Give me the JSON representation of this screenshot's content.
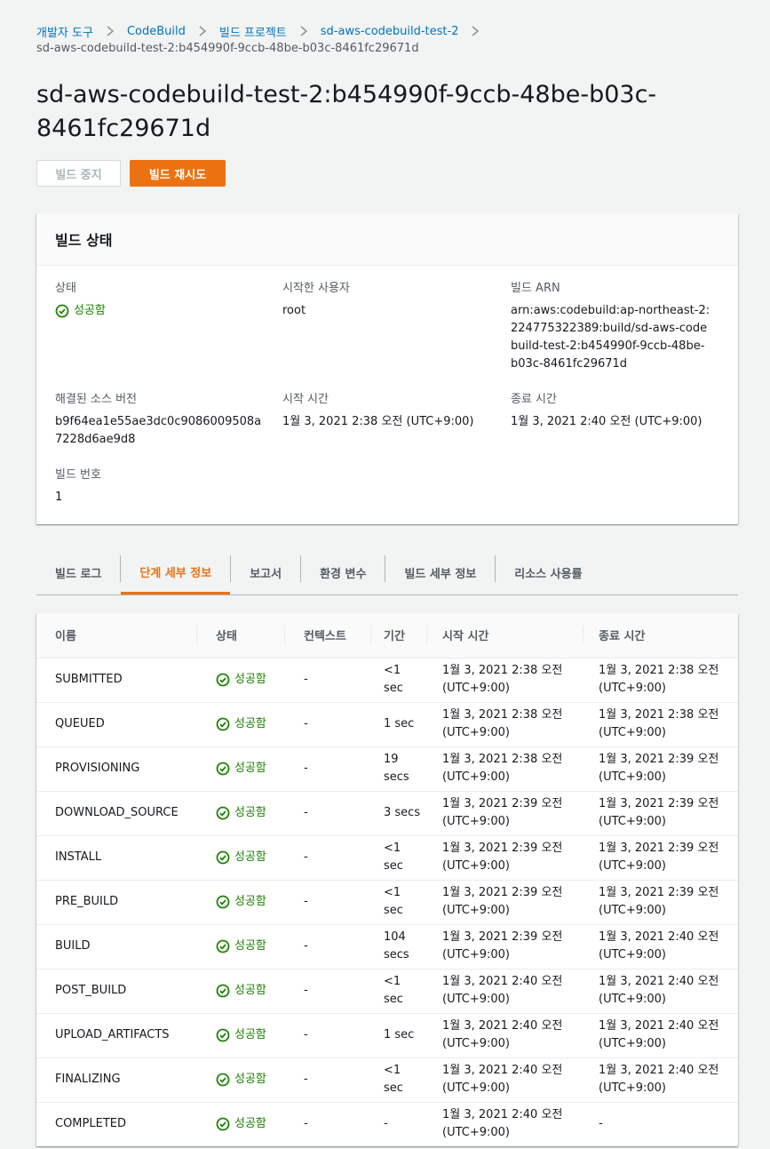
{
  "breadcrumb": {
    "items": [
      "개발자 도구",
      "CodeBuild",
      "빌드 프로젝트",
      "sd-aws-codebuild-test-2"
    ],
    "current": "sd-aws-codebuild-test-2:b454990f-9ccb-48be-b03c-8461fc29671d"
  },
  "page": {
    "title": "sd-aws-codebuild-test-2:b454990f-9ccb-48be-b03c-8461fc29671d"
  },
  "actions": {
    "stop_label": "빌드 중지",
    "retry_label": "빌드 재시도"
  },
  "colors": {
    "accent": "#ec7211",
    "link": "#0073bb",
    "success": "#1d8102"
  },
  "build_status": {
    "heading": "빌드 상태",
    "status_label": "상태",
    "status_value": "성공함",
    "initiator_label": "시작한 사용자",
    "initiator_value": "root",
    "arn_label": "빌드 ARN",
    "arn_value": "arn:aws:codebuild:ap-northeast-2:224775322389:build/sd-aws-codebuild-test-2:b454990f-9ccb-48be-b03c-8461fc29671d",
    "source_version_label": "해결된 소스 버전",
    "source_version_value": "b9f64ea1e55ae3dc0c9086009508a7228d6ae9d8",
    "start_time_label": "시작 시간",
    "start_time_value": "1월 3, 2021 2:38 오전 (UTC+9:00)",
    "end_time_label": "종료 시간",
    "end_time_value": "1월 3, 2021 2:40 오전 (UTC+9:00)",
    "build_number_label": "빌드 번호",
    "build_number_value": "1"
  },
  "tabs": [
    {
      "label": "빌드 로그"
    },
    {
      "label": "단계 세부 정보"
    },
    {
      "label": "보고서"
    },
    {
      "label": "환경 변수"
    },
    {
      "label": "빌드 세부 정보"
    },
    {
      "label": "리소스 사용률"
    }
  ],
  "phase_table": {
    "headers": [
      "이름",
      "상태",
      "컨텍스트",
      "기간",
      "시작 시간",
      "종료 시간"
    ],
    "rows": [
      {
        "name": "SUBMITTED",
        "status": "성공함",
        "context": "-",
        "duration": "<1 sec",
        "start": "1월 3, 2021 2:38 오전 (UTC+9:00)",
        "end": "1월 3, 2021 2:38 오전 (UTC+9:00)"
      },
      {
        "name": "QUEUED",
        "status": "성공함",
        "context": "-",
        "duration": "1 sec",
        "start": "1월 3, 2021 2:38 오전 (UTC+9:00)",
        "end": "1월 3, 2021 2:38 오전 (UTC+9:00)"
      },
      {
        "name": "PROVISIONING",
        "status": "성공함",
        "context": "-",
        "duration": "19 secs",
        "start": "1월 3, 2021 2:38 오전 (UTC+9:00)",
        "end": "1월 3, 2021 2:39 오전 (UTC+9:00)"
      },
      {
        "name": "DOWNLOAD_SOURCE",
        "status": "성공함",
        "context": "-",
        "duration": "3 secs",
        "start": "1월 3, 2021 2:39 오전 (UTC+9:00)",
        "end": "1월 3, 2021 2:39 오전 (UTC+9:00)"
      },
      {
        "name": "INSTALL",
        "status": "성공함",
        "context": "-",
        "duration": "<1 sec",
        "start": "1월 3, 2021 2:39 오전 (UTC+9:00)",
        "end": "1월 3, 2021 2:39 오전 (UTC+9:00)"
      },
      {
        "name": "PRE_BUILD",
        "status": "성공함",
        "context": "-",
        "duration": "<1 sec",
        "start": "1월 3, 2021 2:39 오전 (UTC+9:00)",
        "end": "1월 3, 2021 2:39 오전 (UTC+9:00)"
      },
      {
        "name": "BUILD",
        "status": "성공함",
        "context": "-",
        "duration": "104 secs",
        "start": "1월 3, 2021 2:39 오전 (UTC+9:00)",
        "end": "1월 3, 2021 2:40 오전 (UTC+9:00)"
      },
      {
        "name": "POST_BUILD",
        "status": "성공함",
        "context": "-",
        "duration": "<1 sec",
        "start": "1월 3, 2021 2:40 오전 (UTC+9:00)",
        "end": "1월 3, 2021 2:40 오전 (UTC+9:00)"
      },
      {
        "name": "UPLOAD_ARTIFACTS",
        "status": "성공함",
        "context": "-",
        "duration": "1 sec",
        "start": "1월 3, 2021 2:40 오전 (UTC+9:00)",
        "end": "1월 3, 2021 2:40 오전 (UTC+9:00)"
      },
      {
        "name": "FINALIZING",
        "status": "성공함",
        "context": "-",
        "duration": "<1 sec",
        "start": "1월 3, 2021 2:40 오전 (UTC+9:00)",
        "end": "1월 3, 2021 2:40 오전 (UTC+9:00)"
      },
      {
        "name": "COMPLETED",
        "status": "성공함",
        "context": "-",
        "duration": "-",
        "start": "1월 3, 2021 2:40 오전 (UTC+9:00)",
        "end": "-"
      }
    ]
  }
}
